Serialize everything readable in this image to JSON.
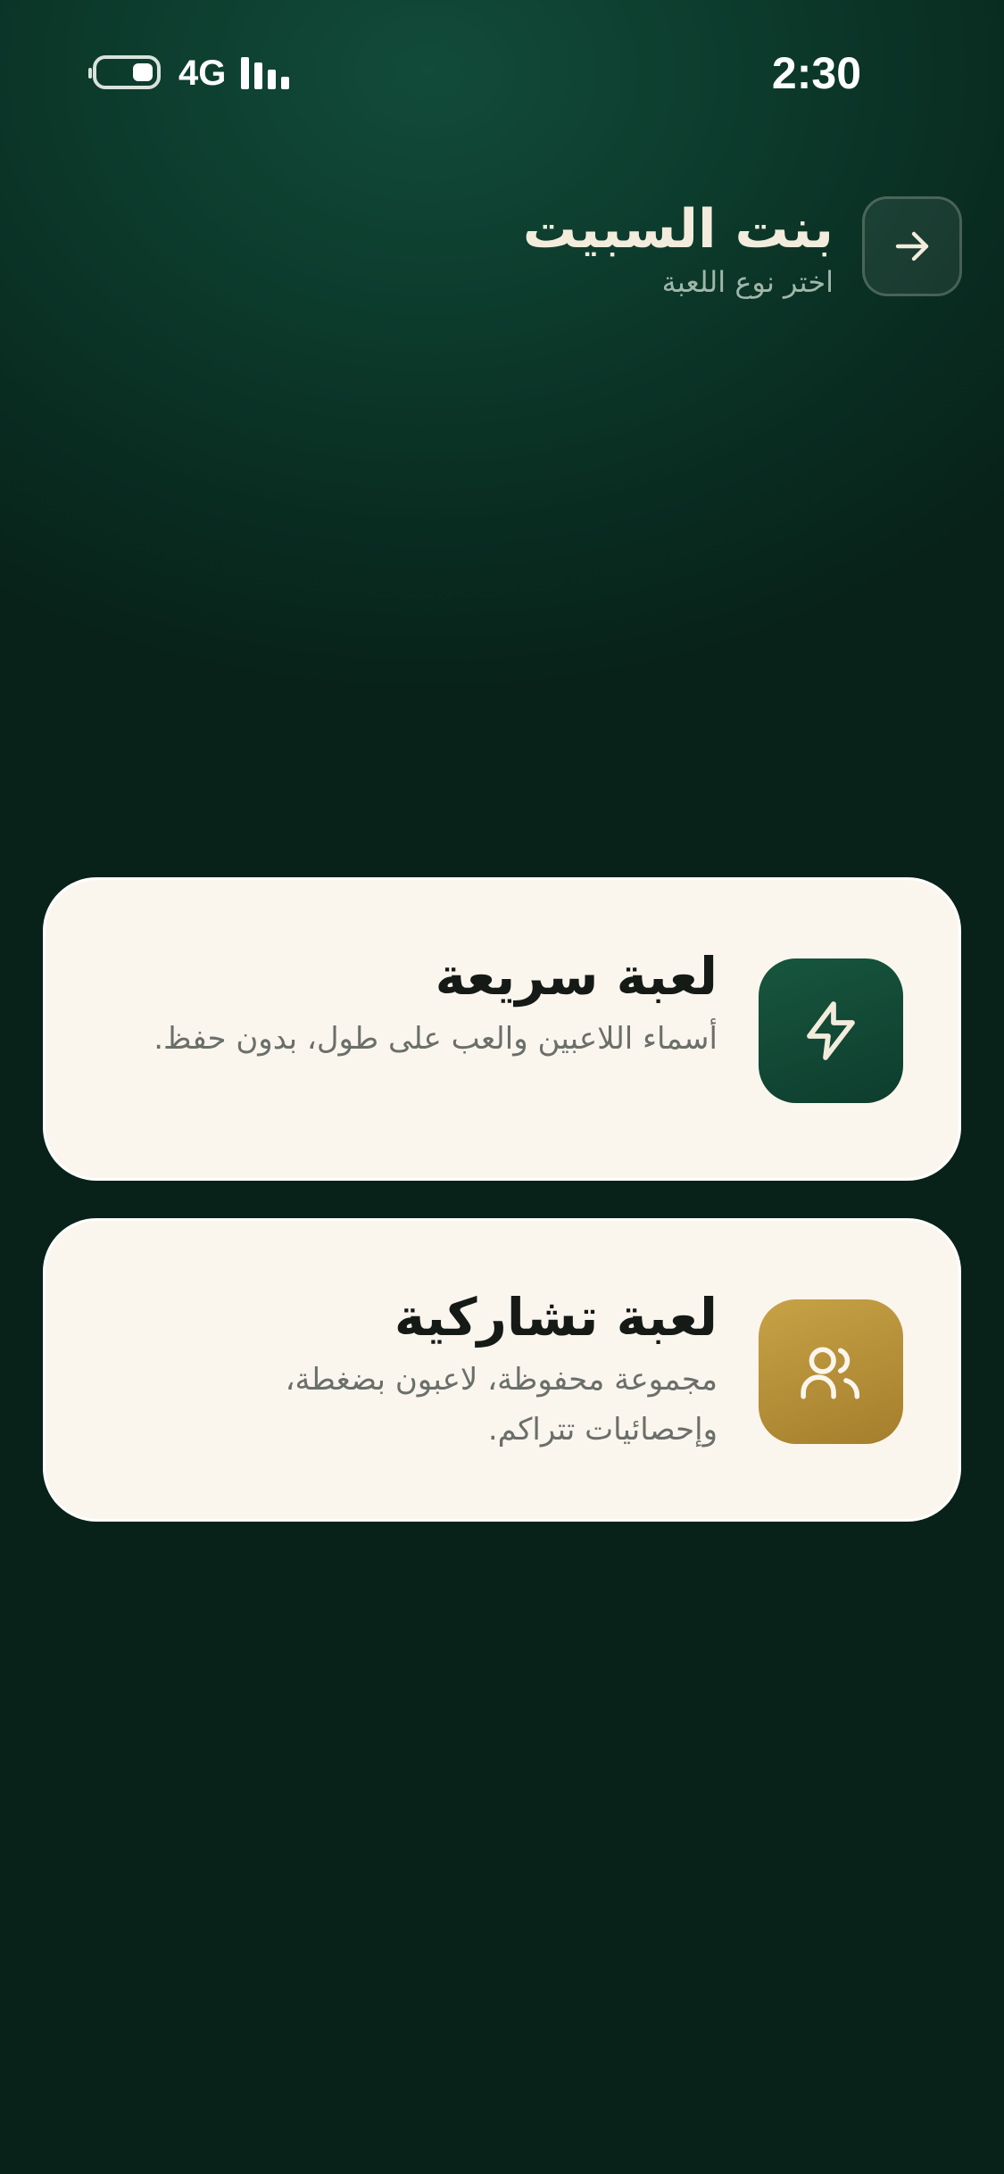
{
  "status_bar": {
    "network": "4G",
    "time": "2:30"
  },
  "header": {
    "title": "بنت السبيت",
    "subtitle": "اختر نوع اللعبة",
    "back_icon": "arrow-right-icon"
  },
  "modes": [
    {
      "title": "لعبة سريعة",
      "description": "أسماء اللاعبين والعب على طول، بدون حفظ.",
      "icon": "lightning-bolt-icon",
      "color": "#124a36"
    },
    {
      "title": "لعبة تشاركية",
      "description": "مجموعة محفوظة، لاعبون بضغطة، وإحصائيات تتراكم.",
      "icon": "users-icon",
      "color": "#b58f38"
    }
  ],
  "colors": {
    "background": "#0b3427",
    "card": "#faf6ee",
    "accent_gold": "#b58f38",
    "accent_green": "#124a36"
  }
}
